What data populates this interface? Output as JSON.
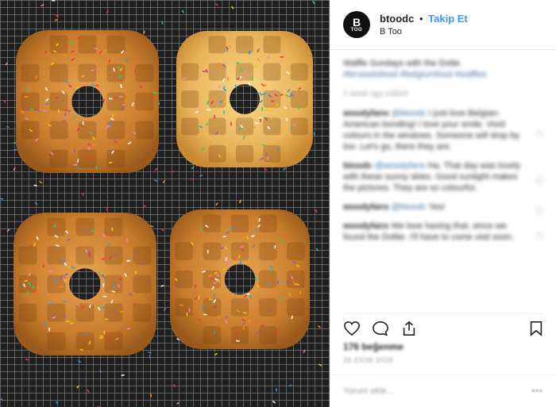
{
  "post": {
    "username": "btoodc",
    "separator": "•",
    "follow_label": "Takip Et",
    "display_name": "B Too",
    "avatar_text": "B",
    "avatar_subtext": "TOO",
    "caption": {
      "text": "Waffle Sundays with the Dotte.",
      "tags": "#brusselsfood #belgiumfood #waffles"
    },
    "edited": "1 week ago edited",
    "comments": [
      {
        "user": "woodyfans",
        "mention": "@btoodc",
        "text": "I just love Belgian-American bonding! I love your smile. Vivid colours in the windows. Someone will drop by too. Let's go, there they are."
      },
      {
        "user": "btoodc",
        "mention": "@woodyfans",
        "text": "Ha. That day was lovely with these sunny skies. Good sunlight makes the pictures. They are so colourful."
      },
      {
        "user": "woodyfans",
        "mention": "@btoodc",
        "text": "Yes!"
      },
      {
        "user": "woodyfans",
        "mention": "",
        "text": "We love having that, since we found the Dottie. I'll have to come visit soon."
      }
    ],
    "likes": "176 beğenme",
    "date": "26 EKİM 2018",
    "add_comment_placeholder": "Yorum ekle...",
    "more_label": "•••"
  },
  "colors": {
    "follow": "#3897f0",
    "tag": "#3f729b",
    "divider": "#efefef"
  },
  "icons": [
    "heart-icon",
    "comment-icon",
    "share-icon",
    "bookmark-icon"
  ]
}
